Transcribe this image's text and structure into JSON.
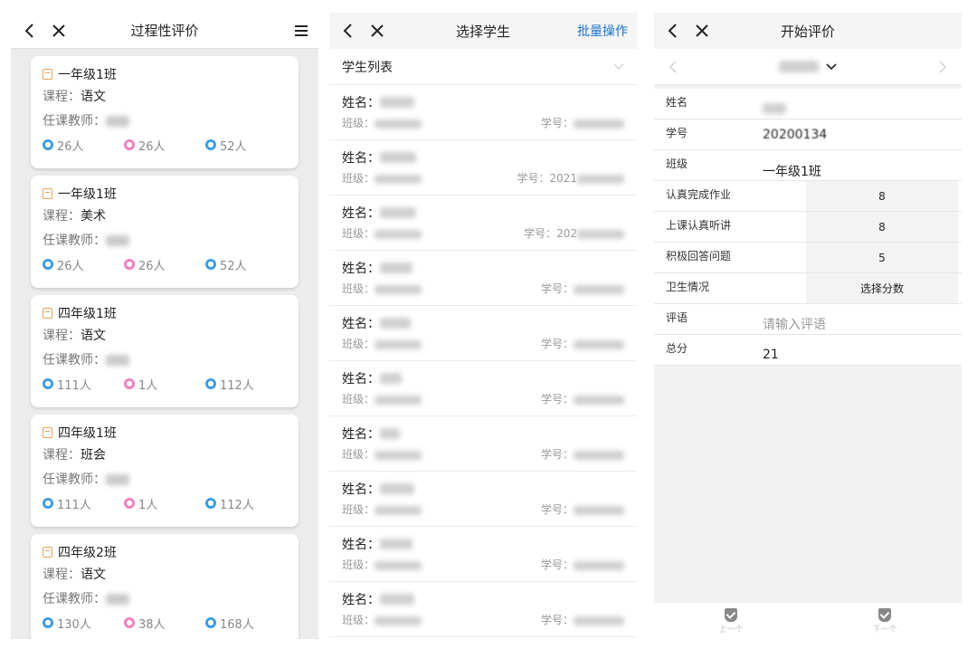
{
  "panel1": {
    "title": "过程性评价",
    "course_prefix": "课程：",
    "teacher_prefix": "任课教师：",
    "cards": [
      {
        "class": "一年级1班",
        "course": "语文",
        "boys": "26人",
        "girls": "26人",
        "total": "52人"
      },
      {
        "class": "一年级1班",
        "course": "美术",
        "boys": "26人",
        "girls": "26人",
        "total": "52人"
      },
      {
        "class": "四年级1班",
        "course": "语文",
        "boys": "111人",
        "girls": "1人",
        "total": "112人"
      },
      {
        "class": "四年级1班",
        "course": "班会",
        "boys": "111人",
        "girls": "1人",
        "total": "112人"
      },
      {
        "class": "四年级2班",
        "course": "语文",
        "boys": "130人",
        "girls": "38人",
        "total": "168人"
      }
    ],
    "colors": {
      "boy": "#3d9be0",
      "girl": "#f07fbd",
      "total": "#3d9be0",
      "calendar": "#e8a25a"
    }
  },
  "panel2": {
    "title": "选择学生",
    "action": "批量操作",
    "list_title": "学生列表",
    "name_prefix": "姓名：",
    "class_prefix": "班级：",
    "id_prefix": "学号：",
    "students": [
      {
        "id_visible": ""
      },
      {
        "id_visible": "2021"
      },
      {
        "id_visible": "202"
      },
      {
        "id_visible": ""
      },
      {
        "id_visible": ""
      },
      {
        "id_visible": ""
      },
      {
        "id_visible": ""
      },
      {
        "id_visible": ""
      },
      {
        "id_visible": ""
      },
      {
        "id_visible": ""
      }
    ]
  },
  "panel3": {
    "title": "开始评价",
    "fields": {
      "name_label": "姓名",
      "id_label": "学号",
      "id_value": "20200134",
      "class_label": "班级",
      "class_value": "一年级1班",
      "homework_label": "认真完成作业",
      "homework_value": "8",
      "listen_label": "上课认真听讲",
      "listen_value": "8",
      "answer_label": "积极回答问题",
      "answer_value": "5",
      "hygiene_label": "卫生情况",
      "hygiene_value": "选择分数",
      "comment_label": "评语",
      "comment_placeholder": "请输入评语",
      "total_label": "总分",
      "total_value": "21"
    },
    "prev_label": "上一个",
    "next_label": "下一个"
  }
}
